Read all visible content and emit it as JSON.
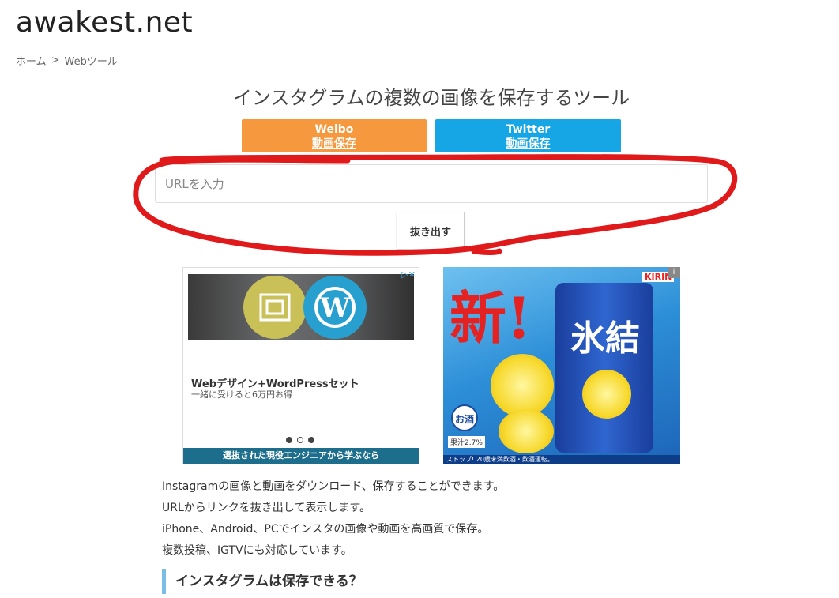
{
  "site": {
    "title": "awakest.net"
  },
  "breadcrumb": {
    "home": "ホーム",
    "separator": ">",
    "current": "Webツール"
  },
  "page_title": "インスタグラムの複数の画像を保存するツール",
  "service_buttons": {
    "weibo": {
      "name": "Weibo",
      "label": "動画保存",
      "color": "#f6983e"
    },
    "twitter": {
      "name": "Twitter",
      "label": "動画保存",
      "color": "#16a6e6"
    }
  },
  "url_input": {
    "placeholder": "URLを入力",
    "value": ""
  },
  "extract_button": {
    "label": "抜き出す"
  },
  "ads": {
    "ad1": {
      "title": "Webデザイン+WordPressセット",
      "subtitle": "一緒に受けると6万円お得",
      "banner": "選抜された現役エンジニアから学ぶなら"
    },
    "ad2": {
      "headline": "新!",
      "product": "氷結",
      "brand": "KIRIN",
      "badge": "お酒",
      "juice": "果汁2.7%",
      "footer": "ストップ! 20歳未満飲酒・飲酒運転。"
    }
  },
  "description": [
    "Instagramの画像と動画をダウンロード、保存することができます。",
    "URLからリンクを抜き出して表示します。",
    "iPhone、Android、PCでインスタの画像や動画を高画質で保存。",
    "複数投稿、IGTVにも対応しています。"
  ],
  "section_heading": "インスタグラムは保存できる？"
}
